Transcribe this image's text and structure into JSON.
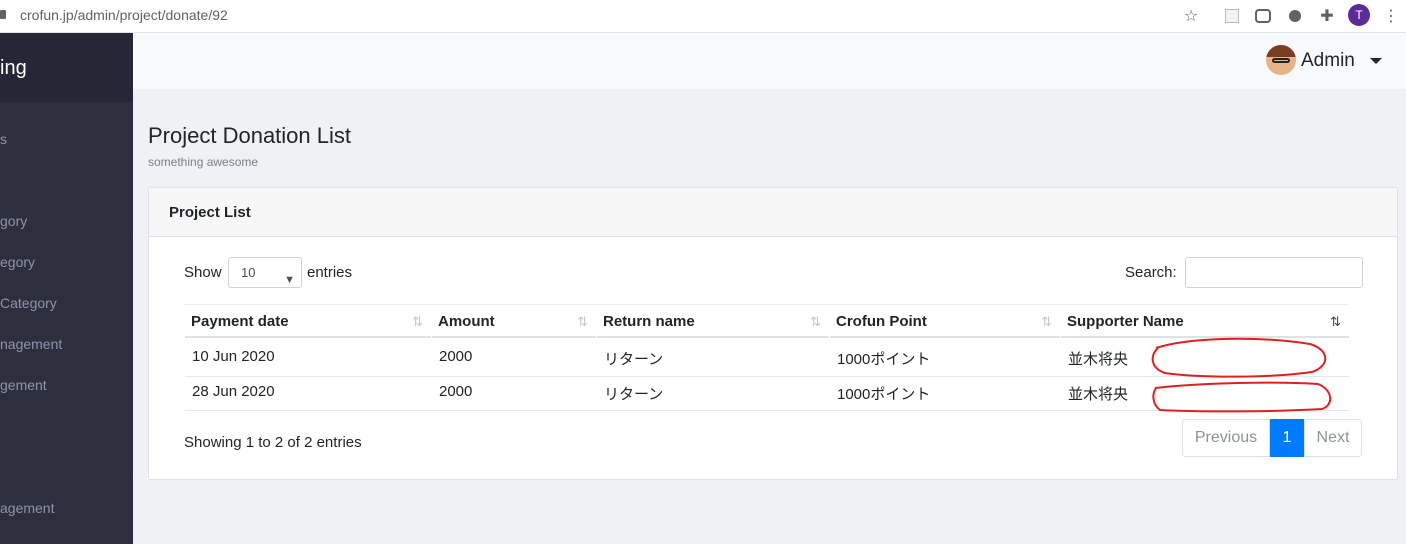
{
  "browser": {
    "url": "crofun.jp/admin/project/donate/92",
    "profile_initial": "T"
  },
  "sidebar": {
    "brand": "ing",
    "items": [
      {
        "label": "s"
      },
      {
        "label": "gory"
      },
      {
        "label": "egory"
      },
      {
        "label": " Category"
      },
      {
        "label": "nagement"
      },
      {
        "label": "gement"
      },
      {
        "label": "agement"
      }
    ]
  },
  "topbar": {
    "user_name": "Admin"
  },
  "page": {
    "title": "Project Donation List",
    "subtitle": "something awesome"
  },
  "card": {
    "title": "Project List",
    "show_label": "Show",
    "length_value": "10",
    "entries_label": "entries",
    "search_label": "Search:",
    "search_value": "",
    "columns": [
      "Payment date",
      "Amount",
      "Return name",
      "Crofun Point",
      "Supporter Name"
    ],
    "rows": [
      [
        "10 Jun 2020",
        "2000",
        "リターン",
        "1000ポイント",
        "並木将央"
      ],
      [
        "28 Jun 2020",
        "2000",
        "リターン",
        "1000ポイント",
        "並木将央"
      ]
    ],
    "info": "Showing 1 to 2 of 2 entries",
    "pagination": {
      "previous": "Previous",
      "current": "1",
      "next": "Next"
    }
  },
  "colors": {
    "sidebar_bg": "#2d2f3e",
    "accent": "#007bff",
    "redaction": "#e02020"
  }
}
